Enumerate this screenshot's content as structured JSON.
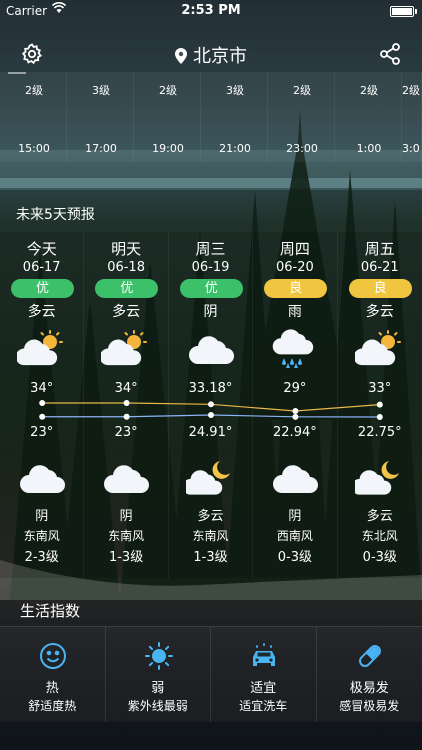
{
  "status_bar": {
    "carrier": "Carrier",
    "time": "2:53 PM"
  },
  "header": {
    "city": "北京市"
  },
  "hourly": {
    "wind": [
      "2级",
      "3级",
      "2级",
      "3级",
      "2级",
      "2级",
      "2级"
    ],
    "hours": [
      "15:00",
      "17:00",
      "19:00",
      "21:00",
      "23:00",
      "1:00",
      "3:0"
    ]
  },
  "forecast": {
    "title": "未来5天预报",
    "days": [
      {
        "name": "今天",
        "date": "06-17",
        "aqi": "优",
        "aqi_color": "#3cc06a",
        "day_cond": "多云",
        "day_icon": "partly-cloudy-icon",
        "high": "34°",
        "low": "23°",
        "night_icon": "cloud-icon",
        "night_cond": "阴",
        "wind_dir": "东南风",
        "wind_level": "2-3级"
      },
      {
        "name": "明天",
        "date": "06-18",
        "aqi": "优",
        "aqi_color": "#3cc06a",
        "day_cond": "多云",
        "day_icon": "partly-cloudy-icon",
        "high": "34°",
        "low": "23°",
        "night_icon": "cloud-icon",
        "night_cond": "阴",
        "wind_dir": "东南风",
        "wind_level": "1-3级"
      },
      {
        "name": "周三",
        "date": "06-19",
        "aqi": "优",
        "aqi_color": "#3cc06a",
        "day_cond": "阴",
        "day_icon": "cloud-icon",
        "high": "33.18°",
        "low": "24.91°",
        "night_icon": "cloud-moon-icon",
        "night_cond": "多云",
        "wind_dir": "东南风",
        "wind_level": "1-3级"
      },
      {
        "name": "周四",
        "date": "06-20",
        "aqi": "良",
        "aqi_color": "#f0c540",
        "day_cond": "雨",
        "day_icon": "rain-icon",
        "high": "29°",
        "low": "22.94°",
        "night_icon": "cloud-icon",
        "night_cond": "阴",
        "wind_dir": "西南风",
        "wind_level": "0-3级"
      },
      {
        "name": "周五",
        "date": "06-21",
        "aqi": "良",
        "aqi_color": "#f0c540",
        "day_cond": "多云",
        "day_icon": "partly-cloudy-icon",
        "high": "33°",
        "low": "22.75°",
        "night_icon": "cloud-moon-icon",
        "night_cond": "多云",
        "wind_dir": "东北风",
        "wind_level": "0-3级"
      }
    ]
  },
  "life": {
    "title": "生活指数",
    "items": [
      {
        "icon": "smiley-icon",
        "value": "热",
        "desc": "舒适度热"
      },
      {
        "icon": "sun-icon",
        "value": "弱",
        "desc": "紫外线最弱"
      },
      {
        "icon": "car-wash-icon",
        "value": "适宜",
        "desc": "适宜洗车"
      },
      {
        "icon": "pill-icon",
        "value": "极易发",
        "desc": "感冒极易发"
      }
    ]
  },
  "colors": {
    "icon_blue": "#4ab3f4",
    "high_line": "#e8b84a",
    "low_line": "#8ab4f8"
  }
}
